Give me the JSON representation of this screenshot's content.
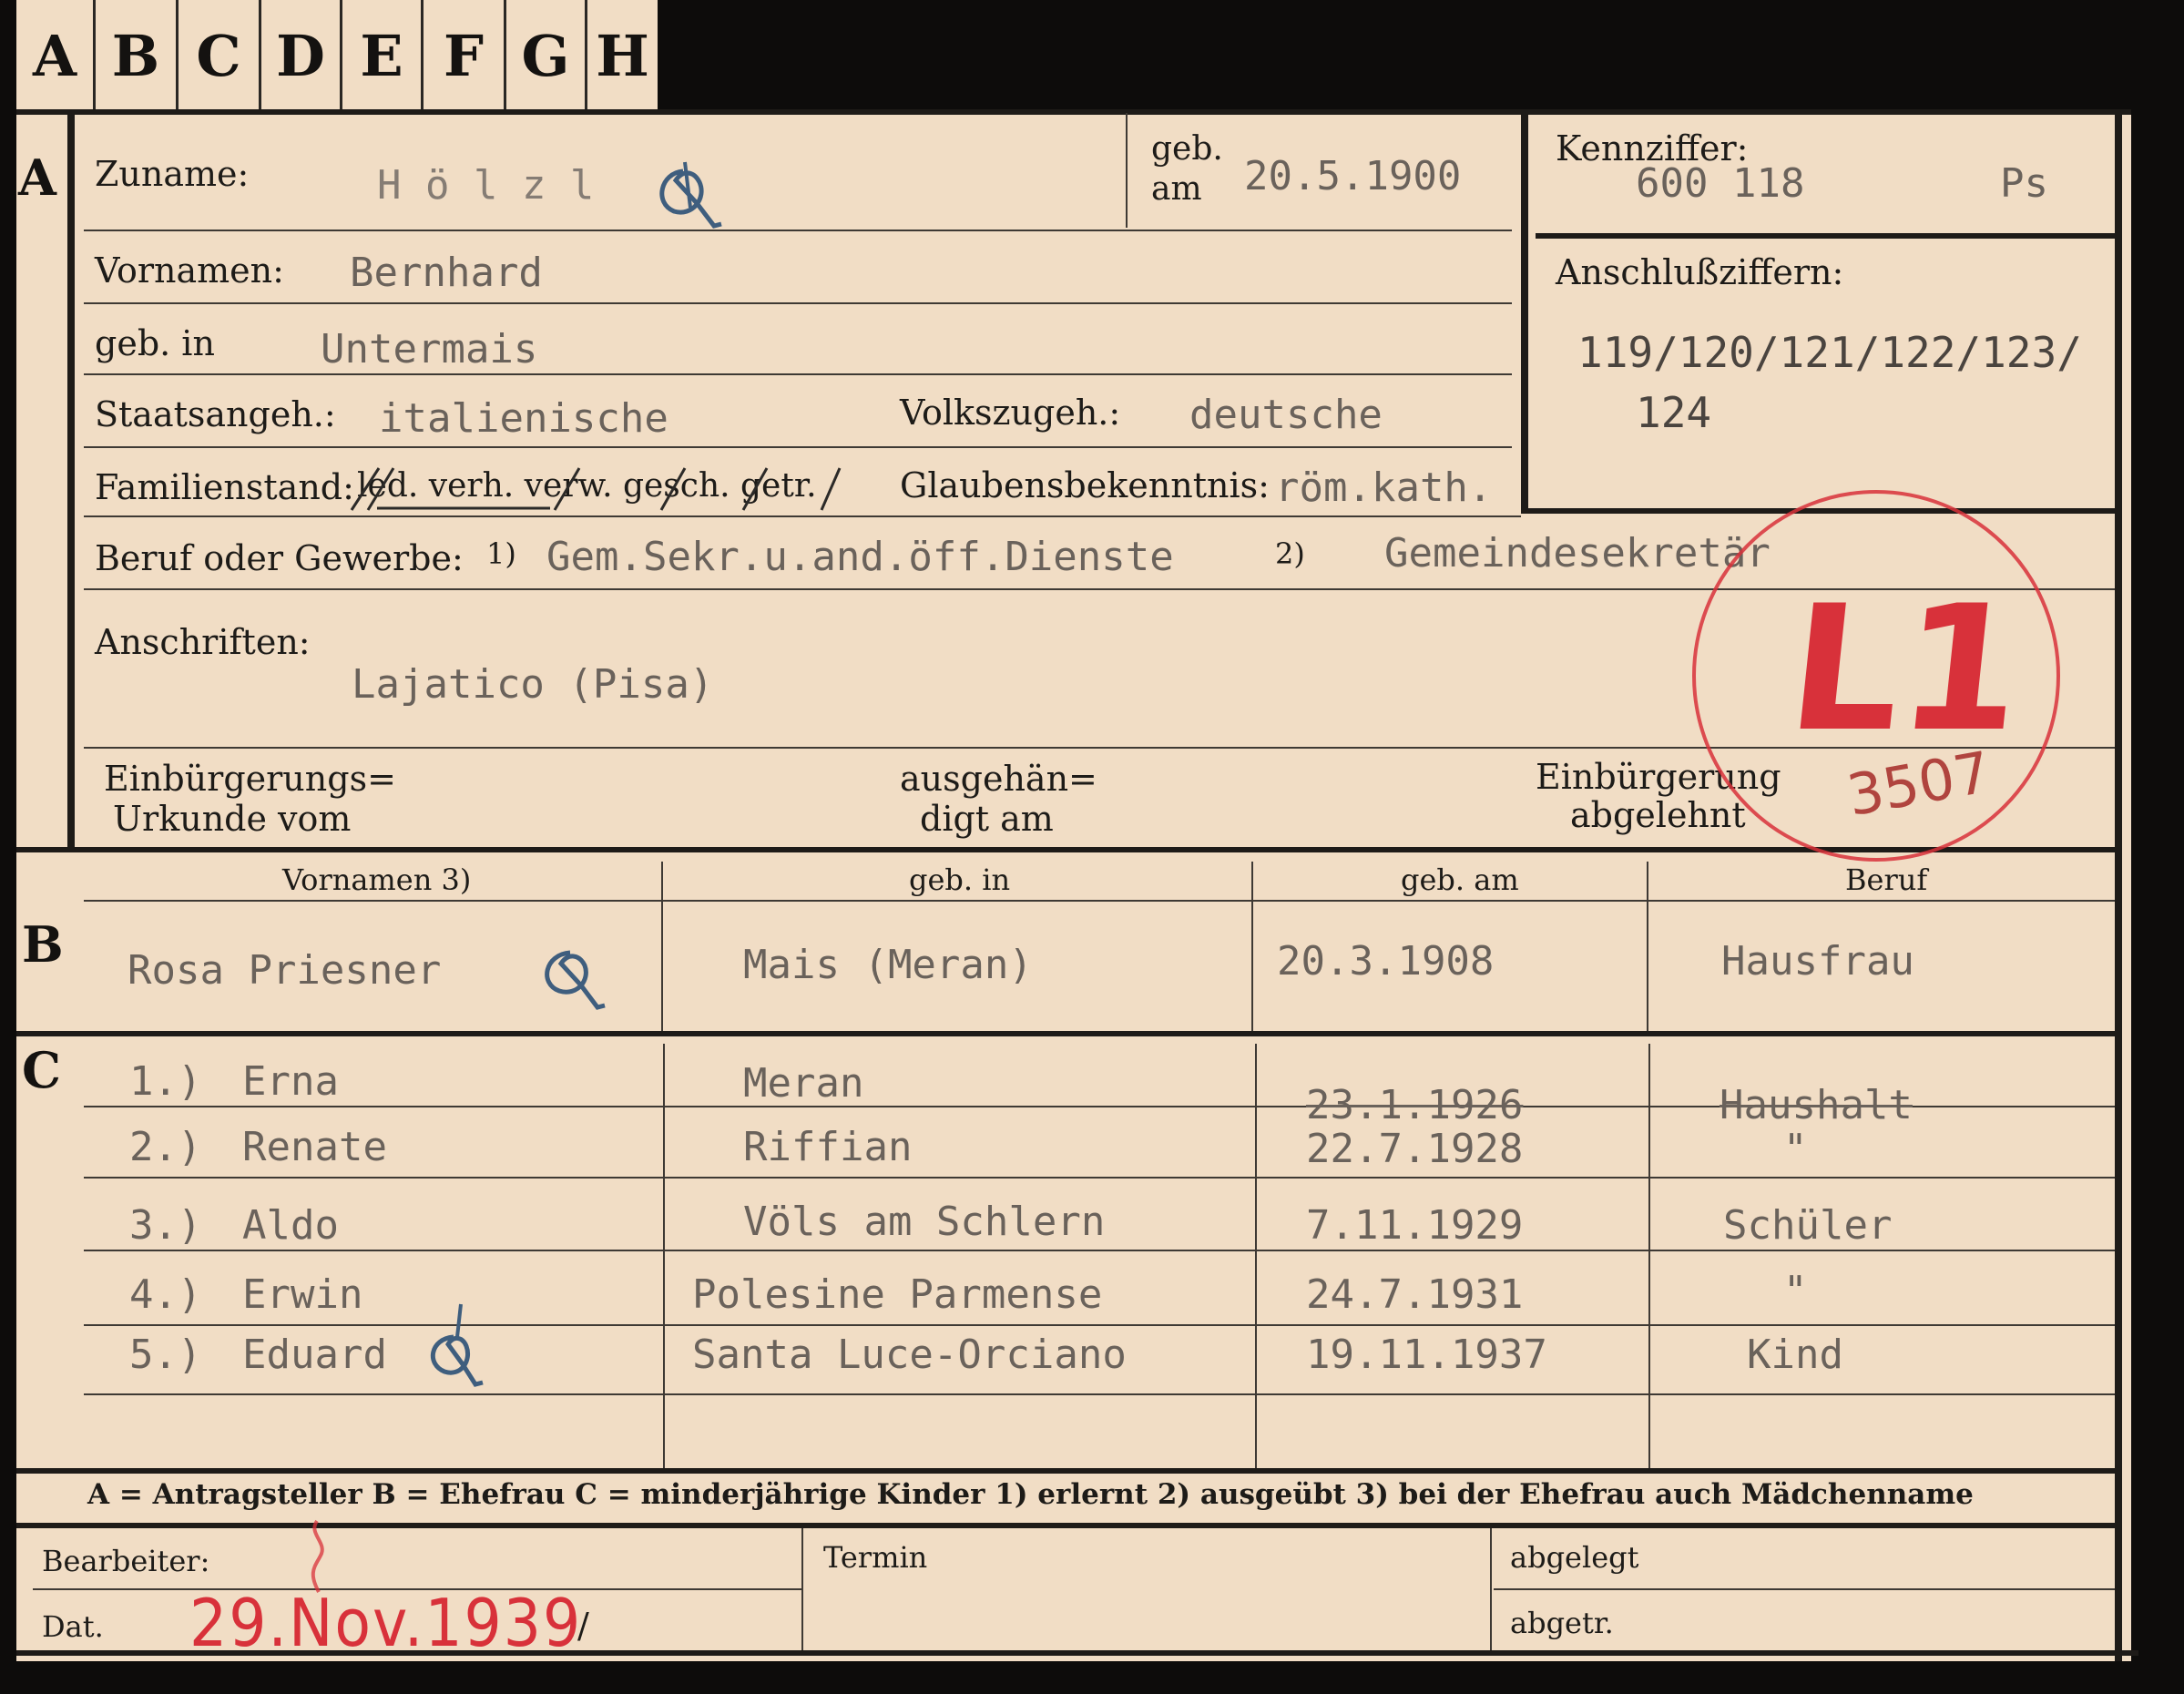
{
  "tabs": [
    "A",
    "B",
    "C",
    "D",
    "E",
    "F",
    "G",
    "H"
  ],
  "sections": {
    "a": "A",
    "b": "B",
    "c": "C"
  },
  "applicant": {
    "surname_label": "Zuname:",
    "surname": "H ö l z l",
    "born_on_label_1": "geb.",
    "born_on_label_2": "am",
    "born_on": "20.5.1900",
    "id_label": "Kennziffer:",
    "id_number": "600 118",
    "id_suffix": "Ps",
    "firstname_label": "Vornamen:",
    "firstname": "Bernhard",
    "birthplace_label": "geb. in",
    "birthplace": "Untermais",
    "connected_label": "Anschlußziffern:",
    "connected_1": "119/120/121/122/123/",
    "connected_2": "124",
    "citizenship_label": "Staatsangeh.:",
    "citizenship": "italienische",
    "ethnicity_label": "Volkszugeh.:",
    "ethnicity": "deutsche",
    "marital_label": "Familienstand:",
    "marital_options": "led. verh. verw. gesch. getr.",
    "religion_label": "Glaubensbekenntnis:",
    "religion": "röm.kath.",
    "profession_label": "Beruf oder Gewerbe:",
    "fn1": "1)",
    "profession_learned": "Gem.Sekr.u.and.öff.Dienste",
    "fn2": "2)",
    "profession_practiced": "Gemeindesekretär",
    "address_label": "Anschriften:",
    "address": "Lajatico (Pisa)",
    "naturalization_label_1": "Einbürgerungs=",
    "naturalization_label_2": "Urkunde vom",
    "handed_label_1": "ausgehän=",
    "handed_label_2": "digt am",
    "rejected_label_1": "Einbürgerung",
    "rejected_label_2": "abgelehnt"
  },
  "stamp": {
    "code": "L1",
    "number": "3507",
    "color": "#d8313a"
  },
  "spouse": {
    "headers": {
      "firstname": "Vornamen 3)",
      "birthplace": "geb. in",
      "birthdate": "geb. am",
      "profession": "Beruf"
    },
    "name": "Rosa Priesner",
    "birthplace": "Mais (Meran)",
    "birthdate": "20.3.1908",
    "profession": "Hausfrau"
  },
  "children": [
    {
      "num": "1.)",
      "name": "Erna",
      "birthplace": "Meran",
      "birthdate": "23.1.1926",
      "profession": "Haushalt"
    },
    {
      "num": "2.)",
      "name": "Renate",
      "birthplace": "Riffian",
      "birthdate": "22.7.1928",
      "profession": "\""
    },
    {
      "num": "3.)",
      "name": "Aldo",
      "birthplace": "Völs am  Schlern",
      "birthdate": "7.11.1929",
      "profession": "Schüler"
    },
    {
      "num": "4.)",
      "name": "Erwin",
      "birthplace": "Polesine Parmense",
      "birthdate": "24.7.1931",
      "profession": "\""
    },
    {
      "num": "5.)",
      "name": "Eduard",
      "birthplace": "Santa Luce-Orciano",
      "birthdate": "19.11.1937",
      "profession": "Kind"
    }
  ],
  "legend": "A = Antragsteller   B = Ehefrau   C = minderjährige Kinder   1) erlernt   2) ausgeübt   3) bei der Ehefrau auch Mädchenname",
  "footer": {
    "clerk_label": "Bearbeiter:",
    "date_label": "Dat.",
    "date_stamp": "29.Nov.1939",
    "date_slash": "/",
    "deadline_label": "Termin",
    "filed_label": "abgelegt",
    "removed_label": "abgetr."
  }
}
